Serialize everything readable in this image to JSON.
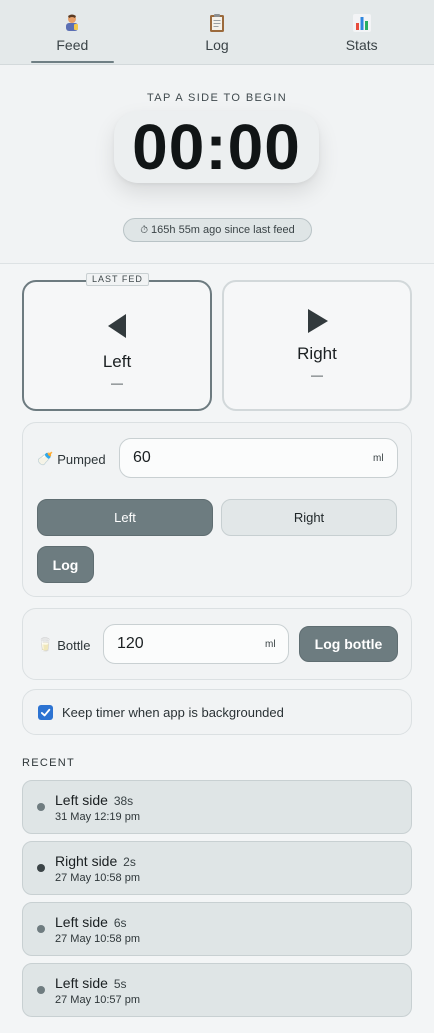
{
  "tabs": [
    {
      "label": "Feed",
      "icon": "baby-feeding-icon",
      "active": true
    },
    {
      "label": "Log",
      "icon": "clipboard-icon",
      "active": false
    },
    {
      "label": "Stats",
      "icon": "bar-chart-icon",
      "active": false
    }
  ],
  "timer": {
    "hint": "TAP A SIDE TO BEGIN",
    "display": "00:00",
    "since_text": "165h 55m ago since last feed"
  },
  "sides": {
    "last_fed_tag": "LAST FED",
    "left": {
      "name": "Left",
      "value": "—"
    },
    "right": {
      "name": "Right",
      "value": "—"
    }
  },
  "pumped": {
    "label": "Pumped",
    "value": "60",
    "unit": "ml",
    "left_btn": "Left",
    "right_btn": "Right",
    "log_btn": "Log"
  },
  "bottle": {
    "label": "Bottle",
    "value": "120",
    "unit": "ml",
    "log_btn": "Log bottle"
  },
  "keep_timer": {
    "label": "Keep timer when app is backgrounded",
    "checked": true
  },
  "recent": {
    "title": "RECENT",
    "items": [
      {
        "side": "Left side",
        "duration": "38s",
        "time": "31 May 12:19 pm",
        "dot_color": "#6f7c80"
      },
      {
        "side": "Right side",
        "duration": "2s",
        "time": "27 May 10:58 pm",
        "dot_color": "#3b4447"
      },
      {
        "side": "Left side",
        "duration": "6s",
        "time": "27 May 10:58 pm",
        "dot_color": "#6f7c80"
      },
      {
        "side": "Left side",
        "duration": "5s",
        "time": "27 May 10:57 pm",
        "dot_color": "#6f7c80"
      }
    ]
  },
  "colors": {
    "accent": "#6d7c80",
    "checkbox": "#2c73d2"
  }
}
